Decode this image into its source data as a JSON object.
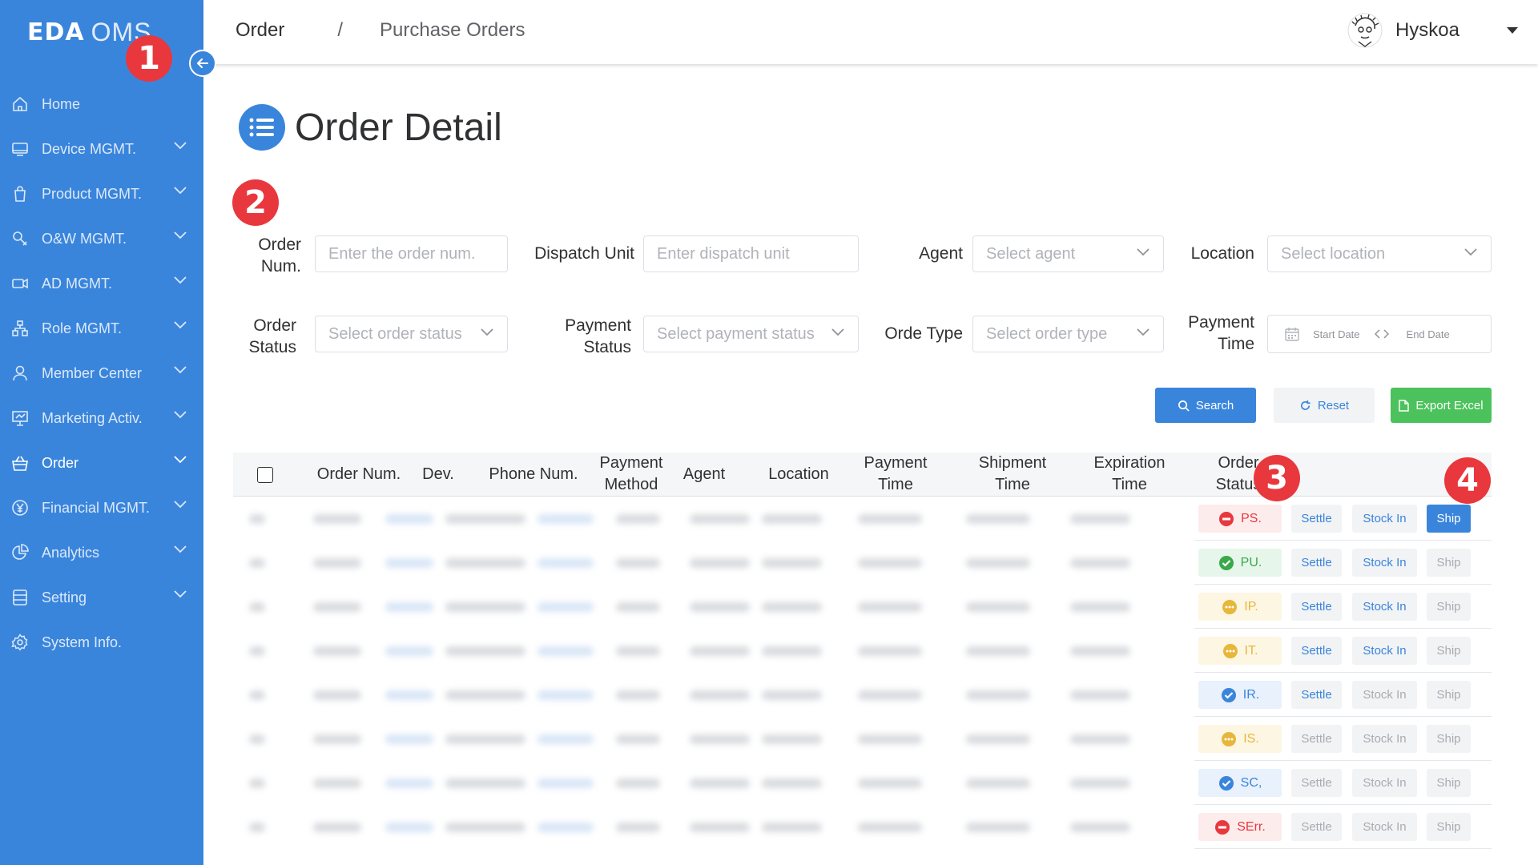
{
  "app": {
    "brand": "EDA",
    "name": "OMS"
  },
  "colors": {
    "primary": "#3a85dc",
    "success": "#4cc25d",
    "danger": "#e8383d",
    "warning": "#e6b73a",
    "badge": "#e8383d"
  },
  "sidebar": {
    "items": [
      {
        "label": "Home",
        "icon": "home-icon"
      },
      {
        "label": "Device MGMT.",
        "icon": "monitor-icon"
      },
      {
        "label": "Product MGMT.",
        "icon": "bag-icon"
      },
      {
        "label": "O&W MGMT.",
        "icon": "wrench-icon"
      },
      {
        "label": "AD MGMT.",
        "icon": "camera-icon"
      },
      {
        "label": "Role MGMT.",
        "icon": "org-icon"
      },
      {
        "label": "Member Center",
        "icon": "user-icon"
      },
      {
        "label": "Marketing Activ.",
        "icon": "presentation-icon"
      },
      {
        "label": "Order",
        "icon": "basket-icon"
      },
      {
        "label": "Financial MGMT.",
        "icon": "yen-icon"
      },
      {
        "label": "Analytics",
        "icon": "pie-icon"
      },
      {
        "label": "Setting",
        "icon": "database-icon"
      },
      {
        "label": "System Info.",
        "icon": "gear-icon"
      }
    ],
    "active": "Order"
  },
  "header": {
    "breadcrumb": [
      "Order",
      "/",
      "Purchase Orders"
    ],
    "user": "Hyskoa"
  },
  "page": {
    "title": "Order Detail"
  },
  "badges": [
    "1",
    "2",
    "3",
    "4"
  ],
  "filters": {
    "order_num": {
      "label_1": "Order",
      "label_2": "Num.",
      "placeholder": "Enter the order num."
    },
    "dispatch_unit": {
      "label": "Dispatch Unit",
      "placeholder": "Enter dispatch unit"
    },
    "agent": {
      "label": "Agent",
      "placeholder": "Select agent"
    },
    "location": {
      "label": "Location",
      "placeholder": "Select location"
    },
    "order_status": {
      "label_1": "Order",
      "label_2": "Status",
      "placeholder": "Select order status"
    },
    "payment_status": {
      "label_1": "Payment",
      "label_2": "Status",
      "placeholder": "Select payment status"
    },
    "order_type": {
      "label": "Orde Type",
      "placeholder": "Select order type"
    },
    "payment_time": {
      "label_1": "Payment",
      "label_2": "Time",
      "start": "Start Date",
      "end": "End Date"
    }
  },
  "actions": {
    "search": "Search",
    "reset": "Reset",
    "export": "Export Excel"
  },
  "table": {
    "columns": [
      {
        "l1": "Order Num.",
        "l2": ""
      },
      {
        "l1": "Dev.",
        "l2": ""
      },
      {
        "l1": "Phone Num.",
        "l2": ""
      },
      {
        "l1": "Payment",
        "l2": "Method"
      },
      {
        "l1": "Agent",
        "l2": ""
      },
      {
        "l1": "Location",
        "l2": ""
      },
      {
        "l1": "Payment",
        "l2": "Time"
      },
      {
        "l1": "Shipment",
        "l2": "Time"
      },
      {
        "l1": "Expiration",
        "l2": "Time"
      },
      {
        "l1": "Order",
        "l2": "Status"
      }
    ],
    "action_labels": {
      "settle": "Settle",
      "stock_in": "Stock In",
      "ship": "Ship"
    },
    "rows": [
      {
        "status": "PS.",
        "tone": "red",
        "icon": "minus-circle-icon",
        "settle_on": true,
        "stock_on": true,
        "ship": "primary"
      },
      {
        "status": "PU.",
        "tone": "green",
        "icon": "check-circle-icon",
        "settle_on": true,
        "stock_on": true,
        "ship": "disabled"
      },
      {
        "status": "IP.",
        "tone": "yellow",
        "icon": "more-circle-icon",
        "settle_on": true,
        "stock_on": true,
        "ship": "disabled"
      },
      {
        "status": "IT.",
        "tone": "yellow",
        "icon": "more-circle-icon",
        "settle_on": true,
        "stock_on": true,
        "ship": "disabled"
      },
      {
        "status": "IR.",
        "tone": "blue",
        "icon": "check-circle-icon",
        "settle_on": true,
        "stock_on": false,
        "ship": "disabled"
      },
      {
        "status": "IS.",
        "tone": "yellow",
        "icon": "more-circle-icon",
        "settle_on": false,
        "stock_on": false,
        "ship": "disabled"
      },
      {
        "status": "SC,",
        "tone": "blue",
        "icon": "check-circle-icon",
        "settle_on": false,
        "stock_on": false,
        "ship": "disabled"
      },
      {
        "status": "SErr.",
        "tone": "red",
        "icon": "minus-circle-icon",
        "settle_on": false,
        "stock_on": false,
        "ship": "disabled"
      }
    ]
  }
}
